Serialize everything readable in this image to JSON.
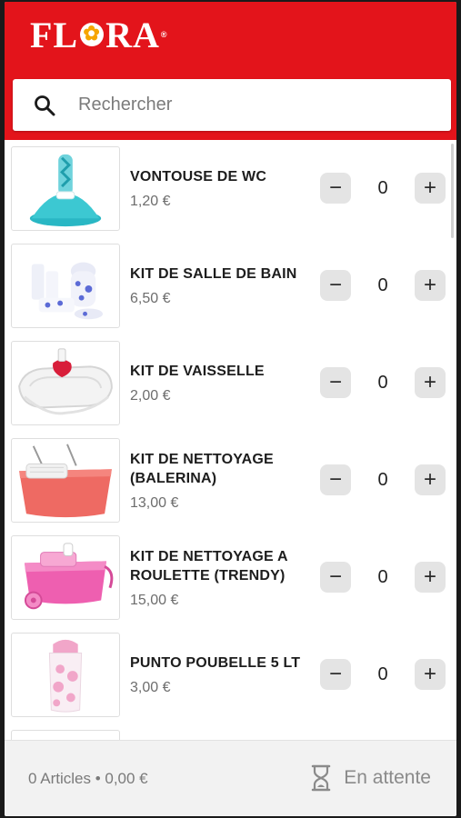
{
  "header": {
    "brand": "FLORA",
    "brand_color": "#e3141b"
  },
  "search": {
    "placeholder": "Rechercher",
    "value": "",
    "icon": "search-icon"
  },
  "products": [
    {
      "name": "VONTOUSE DE WC",
      "price": "1,20 €",
      "quantity": "0",
      "image": "toilet-plunger"
    },
    {
      "name": "KIT DE SALLE DE BAIN",
      "price": "6,50 €",
      "quantity": "0",
      "image": "bathroom-kit"
    },
    {
      "name": "KIT DE VAISSELLE",
      "price": "2,00 €",
      "quantity": "0",
      "image": "dish-rack"
    },
    {
      "name": "KIT DE NETTOYAGE (BALERINA)",
      "price": "13,00 €",
      "quantity": "0",
      "image": "mop-bucket-coral"
    },
    {
      "name": "KIT DE NETTOYAGE A ROULETTE (TRENDY)",
      "price": "15,00 €",
      "quantity": "0",
      "image": "mop-bucket-pink-wheels"
    },
    {
      "name": "PUNTO POUBELLE 5 LT",
      "price": "3,00 €",
      "quantity": "0",
      "image": "trash-bin"
    }
  ],
  "controls": {
    "minus": "−",
    "plus": "+"
  },
  "footer": {
    "summary": "0 Articles • 0,00 €",
    "status": "En attente",
    "status_icon": "hourglass-icon"
  }
}
